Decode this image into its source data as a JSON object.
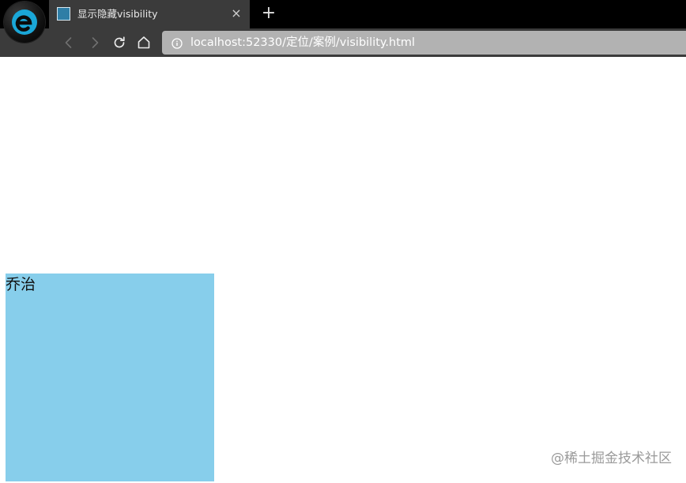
{
  "browser": {
    "tab": {
      "title": "显示隐藏visibility",
      "close_glyph": "×",
      "favicon": "page-favicon-icon"
    },
    "new_tab_glyph": "+",
    "address": {
      "url": "localhost:52330/定位/案例/visibility.html"
    },
    "icons": [
      "browser-logo-icon",
      "back-arrow-icon",
      "forward-arrow-icon",
      "reload-icon",
      "home-icon",
      "site-info-icon"
    ],
    "colors": {
      "titlebar": "#000000",
      "toolbar": "#3b3b3b",
      "address_bar": "#b2b2b2"
    }
  },
  "page": {
    "box": {
      "text": "乔治",
      "color": "#87ceeb"
    },
    "watermark": "@稀土掘金技术社区"
  }
}
